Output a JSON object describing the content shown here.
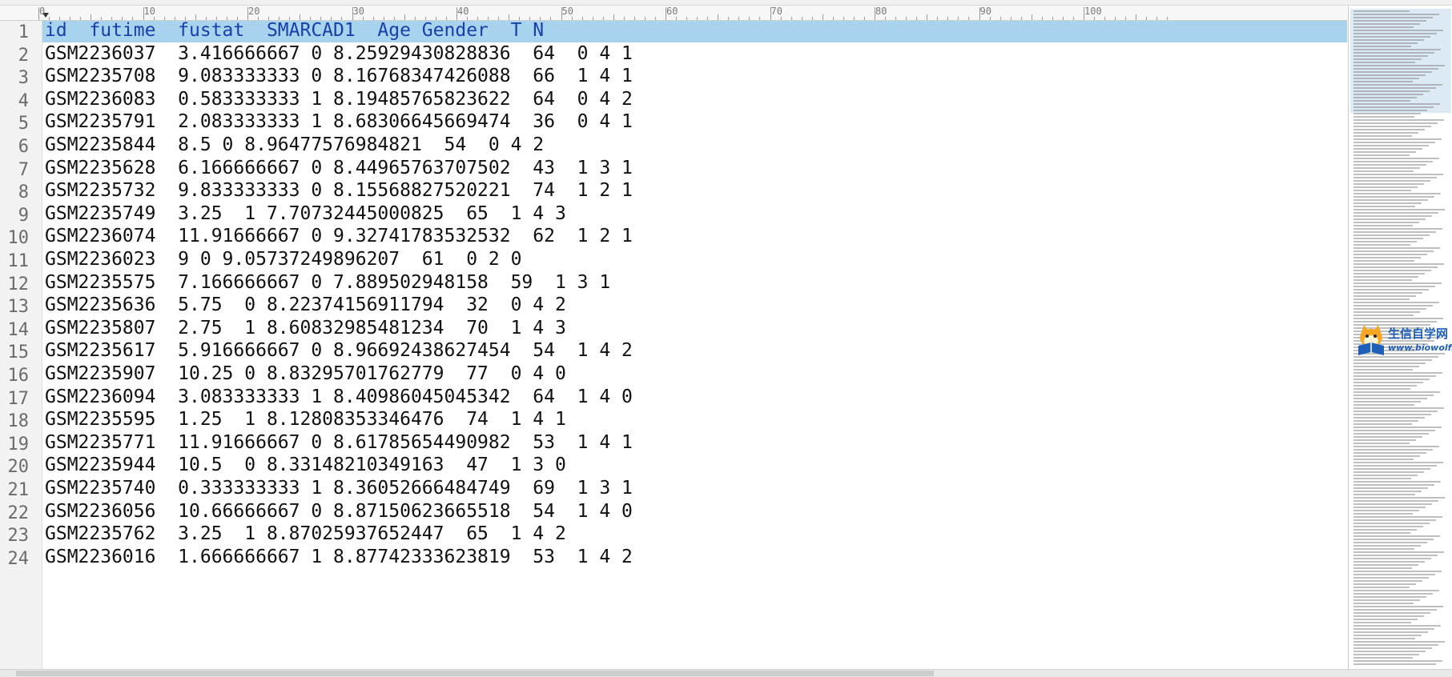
{
  "ruler": {
    "labels": [
      "0",
      "10",
      "20",
      "30",
      "40",
      "50",
      "60",
      "70",
      "80",
      "90",
      "100"
    ]
  },
  "document": {
    "lines": [
      {
        "no": "1",
        "text": "id  futime  fustat  SMARCAD1  Age Gender  T N"
      },
      {
        "no": "2",
        "text": "GSM2236037  3.416666667 0 8.25929430828836  64  0 4 1"
      },
      {
        "no": "3",
        "text": "GSM2235708  9.083333333 0 8.16768347426088  66  1 4 1"
      },
      {
        "no": "4",
        "text": "GSM2236083  0.583333333 1 8.19485765823622  64  0 4 2"
      },
      {
        "no": "5",
        "text": "GSM2235791  2.083333333 1 8.68306645669474  36  0 4 1"
      },
      {
        "no": "6",
        "text": "GSM2235844  8.5 0 8.96477576984821  54  0 4 2"
      },
      {
        "no": "7",
        "text": "GSM2235628  6.166666667 0 8.44965763707502  43  1 3 1"
      },
      {
        "no": "8",
        "text": "GSM2235732  9.833333333 0 8.15568827520221  74  1 2 1"
      },
      {
        "no": "9",
        "text": "GSM2235749  3.25  1 7.70732445000825  65  1 4 3"
      },
      {
        "no": "10",
        "text": "GSM2236074  11.91666667 0 9.32741783532532  62  1 2 1"
      },
      {
        "no": "11",
        "text": "GSM2236023  9 0 9.05737249896207  61  0 2 0"
      },
      {
        "no": "12",
        "text": "GSM2235575  7.166666667 0 7.889502948158  59  1 3 1"
      },
      {
        "no": "13",
        "text": "GSM2235636  5.75  0 8.22374156911794  32  0 4 2"
      },
      {
        "no": "14",
        "text": "GSM2235807  2.75  1 8.60832985481234  70  1 4 3"
      },
      {
        "no": "15",
        "text": "GSM2235617  5.916666667 0 8.96692438627454  54  1 4 2"
      },
      {
        "no": "16",
        "text": "GSM2235907  10.25 0 8.83295701762779  77  0 4 0"
      },
      {
        "no": "17",
        "text": "GSM2236094  3.083333333 1 8.40986045045342  64  1 4 0"
      },
      {
        "no": "18",
        "text": "GSM2235595  1.25  1 8.12808353346476  74  1 4 1"
      },
      {
        "no": "19",
        "text": "GSM2235771  11.91666667 0 8.61785654490982  53  1 4 1"
      },
      {
        "no": "20",
        "text": "GSM2235944  10.5  0 8.33148210349163  47  1 3 0"
      },
      {
        "no": "21",
        "text": "GSM2235740  0.333333333 1 8.36052666484749  69  1 3 1"
      },
      {
        "no": "22",
        "text": "GSM2236056  10.66666667 0 8.87150623665518  54  1 4 0"
      },
      {
        "no": "23",
        "text": "GSM2235762  3.25  1 8.87025937652447  65  1 4 2"
      },
      {
        "no": "24",
        "text": "GSM2236016  1.666666667 1 8.87742333623819  53  1 4 2"
      }
    ]
  },
  "minimap": {
    "logo_text": "生信自学网",
    "logo_url_text": "www.biowolf.cn"
  },
  "colors": {
    "header_highlight": "#a7d3ee",
    "header_text": "#1a3fa8",
    "logo": "#1f5fb8"
  }
}
